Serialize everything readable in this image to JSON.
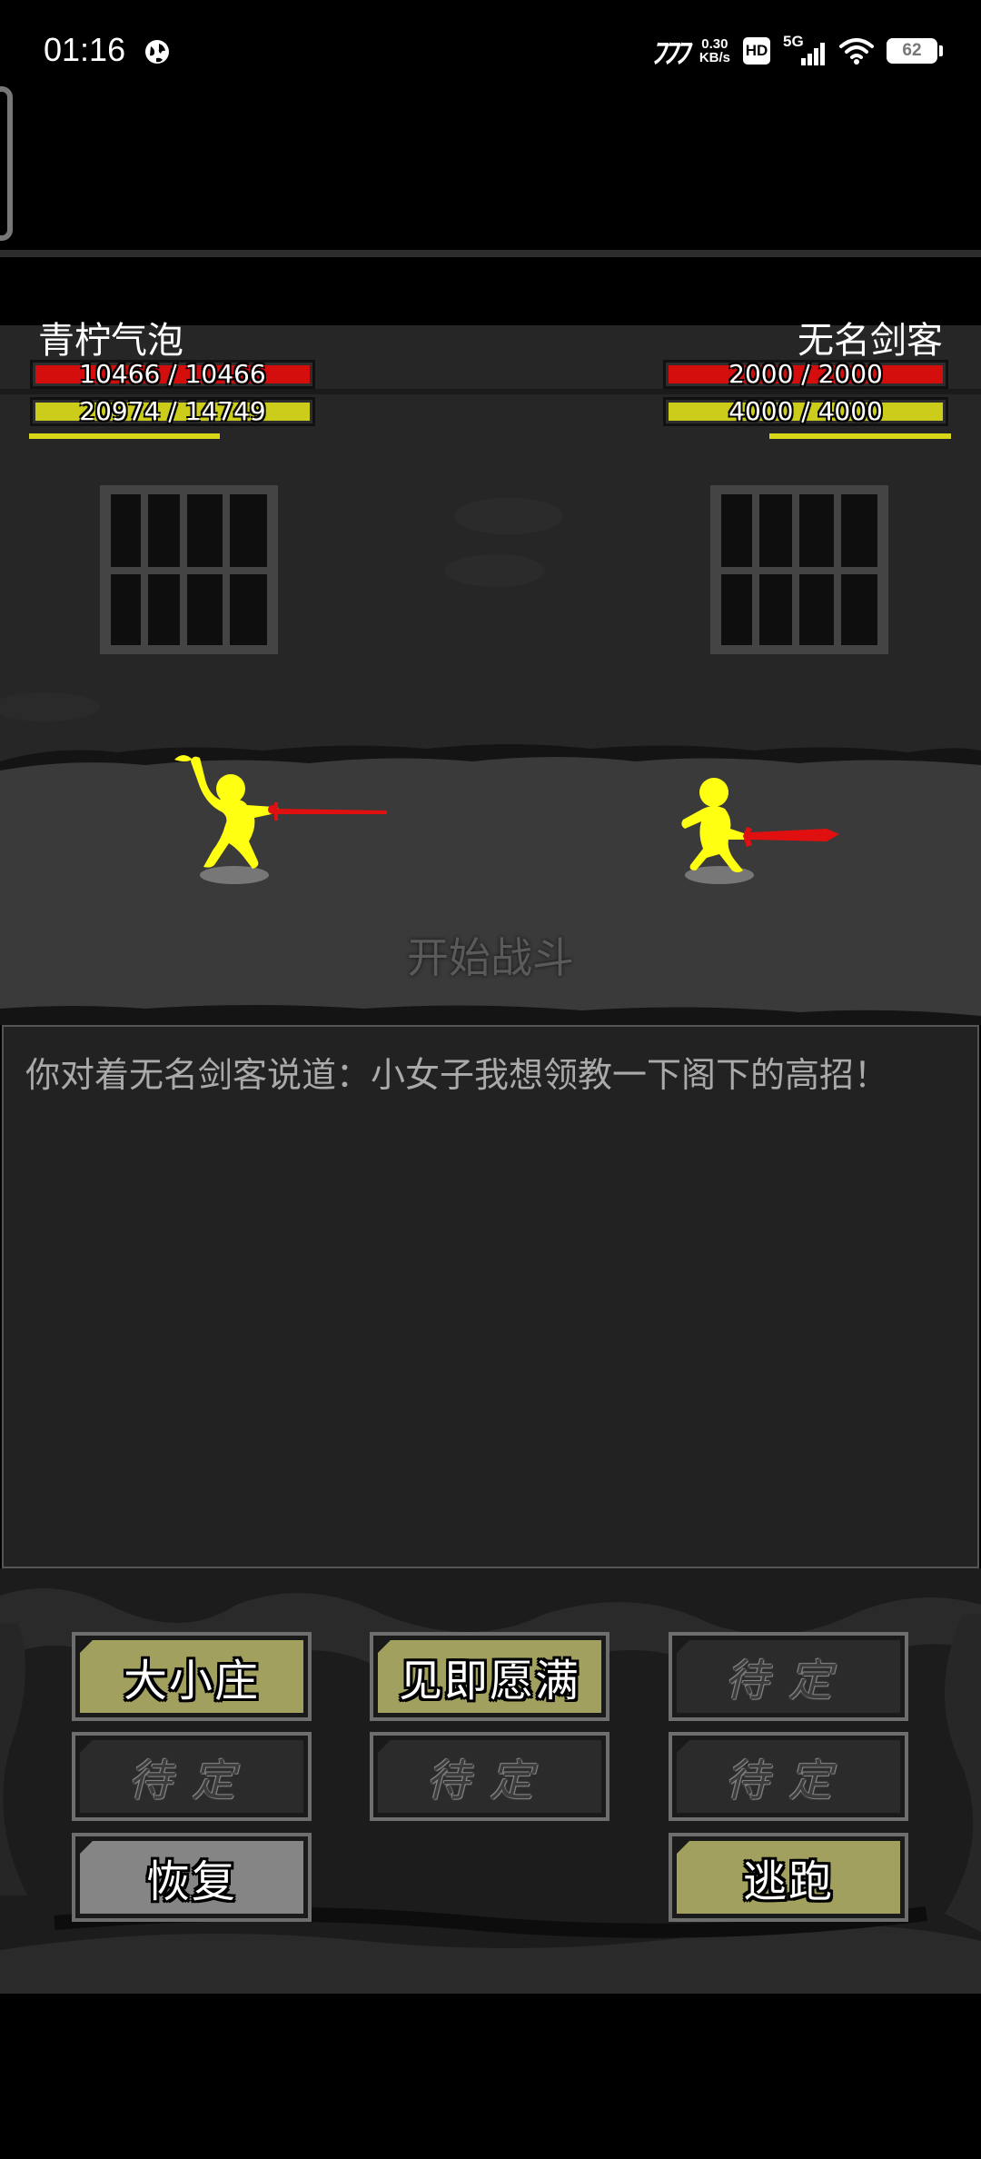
{
  "status_bar": {
    "time": "01:16",
    "speed_value": "0.30",
    "speed_unit": "KB/s",
    "hd": "HD",
    "network": "5G",
    "battery": "62",
    "battery_level": 0.62
  },
  "player": {
    "name": "青柠气泡",
    "hp_text": "10466 / 10466",
    "hp_fraction": 1.0,
    "mp_text": "20974 / 14749",
    "mp_fraction": 1.0,
    "charge_fraction": 0.42
  },
  "enemy": {
    "name": "无名剑客",
    "hp_text": "2000 / 2000",
    "hp_fraction": 1.0,
    "mp_text": "4000 / 4000",
    "mp_fraction": 1.0,
    "charge_fraction": 0.4
  },
  "battle_status": "开始战斗",
  "log_text": "你对着无名剑客说道：小女子我想领教一下阁下的高招！",
  "skills": {
    "s1": "大小庄",
    "s2": "见即愿满",
    "s3": "待定",
    "s4": "待定",
    "s5": "待定",
    "s6": "待定",
    "restore": "恢复",
    "flee": "逃跑"
  },
  "colors": {
    "hp": "#d40d0d",
    "mp": "#cccc1a",
    "fighter": "#ffff11",
    "weapon": "#e01010",
    "skill_active": "#a2a05e"
  }
}
